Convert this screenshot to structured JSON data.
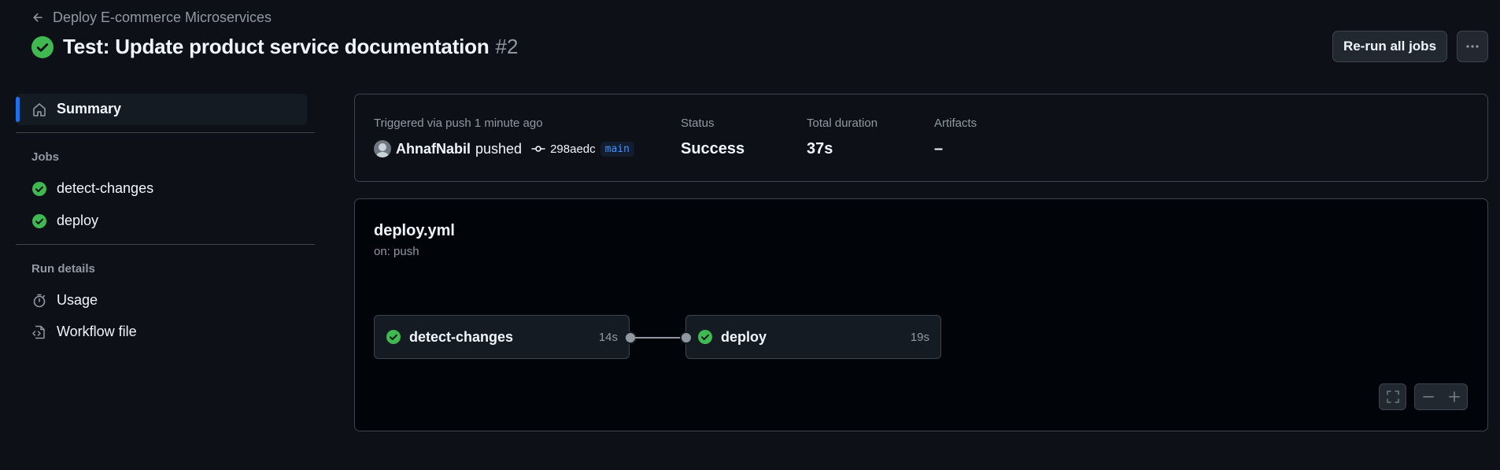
{
  "header": {
    "back_label": "Deploy E-commerce Microservices",
    "title": "Test: Update product service documentation",
    "run_number": "#2",
    "rerun_label": "Re-run all jobs"
  },
  "sidebar": {
    "summary_label": "Summary",
    "jobs_heading": "Jobs",
    "jobs": [
      {
        "label": "detect-changes"
      },
      {
        "label": "deploy"
      }
    ],
    "run_details_heading": "Run details",
    "usage_label": "Usage",
    "workflow_file_label": "Workflow file"
  },
  "summary": {
    "trigger_label": "Triggered via push 1 minute ago",
    "actor": "AhnafNabil",
    "action": "pushed",
    "commit_sha": "298aedc",
    "branch": "main",
    "status_label": "Status",
    "status_value": "Success",
    "duration_label": "Total duration",
    "duration_value": "37s",
    "artifacts_label": "Artifacts",
    "artifacts_value": "–"
  },
  "workflow": {
    "file": "deploy.yml",
    "trigger": "on: push",
    "jobs": [
      {
        "name": "detect-changes",
        "duration": "14s"
      },
      {
        "name": "deploy",
        "duration": "19s"
      }
    ]
  },
  "colors": {
    "background": "#0d1117",
    "success": "#3fb950",
    "accent": "#1f6feb",
    "branch_text": "#4493f8"
  }
}
